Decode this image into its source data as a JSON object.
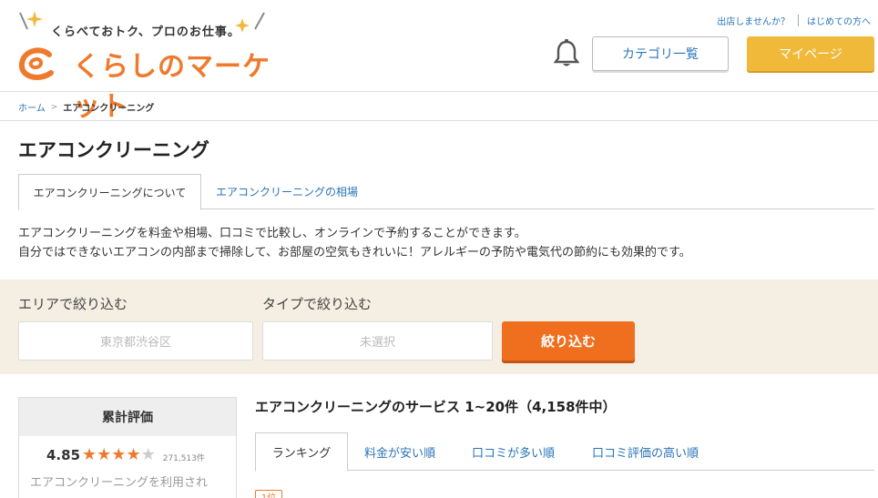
{
  "header": {
    "tagline": "くらべておトク、プロのお仕事。",
    "logo_text": "くらしのマーケット",
    "links": [
      "出店しませんか？",
      "はじめての方へ"
    ],
    "category_button": "カテゴリ一覧",
    "mypage_button": "マイページ",
    "colors": {
      "brand": "#ef7a2c",
      "mypage": "#f0b93a",
      "link": "#2a74b8"
    }
  },
  "breadcrumb": {
    "home": "ホーム",
    "arrow": ">",
    "current": "エアコンクリーニング"
  },
  "page": {
    "title": "エアコンクリーニング",
    "tabs": [
      "エアコンクリーニングについて",
      "エアコンクリーニングの相場"
    ],
    "description": [
      "エアコンクリーニングを料金や相場、口コミで比較し、オンラインで予約することができます。",
      "自分ではできないエアコンの内部まで掃除して、お部屋の空気もきれいに！アレルギーの予防や電気代の節約にも効果的です。"
    ]
  },
  "filter": {
    "area_label": "エリアで絞り込む",
    "area_value": "東京都渋谷区",
    "type_label": "タイプで絞り込む",
    "type_value": "未選択",
    "button": "絞り込む",
    "colors": {
      "background": "#f5efe3",
      "button": "#ef6f1f"
    }
  },
  "rating": {
    "title": "累計評価",
    "score": "4.85",
    "stars": 4,
    "count": "271,513件",
    "note": "エアコンクリーニングを利用され"
  },
  "services": {
    "title": "エアコンクリーニングのサービス 1~20件（4,158件中）",
    "tabs": [
      "ランキング",
      "料金が安い順",
      "口コミが多い順",
      "口コミ評価の高い順"
    ],
    "first_rank": "1位"
  }
}
